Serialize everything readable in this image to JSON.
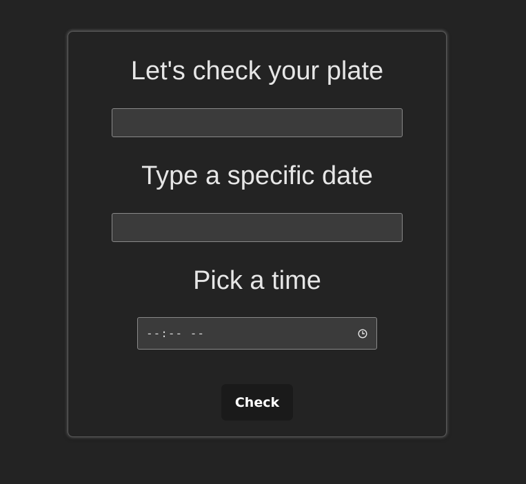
{
  "form": {
    "plate_heading": "Let's check your plate",
    "plate_value": "",
    "date_heading": "Type a specific date",
    "date_value": "",
    "time_heading": "Pick a time",
    "time_value": "--:-- --",
    "time_icon": "clock-icon",
    "submit_label": "Check"
  }
}
